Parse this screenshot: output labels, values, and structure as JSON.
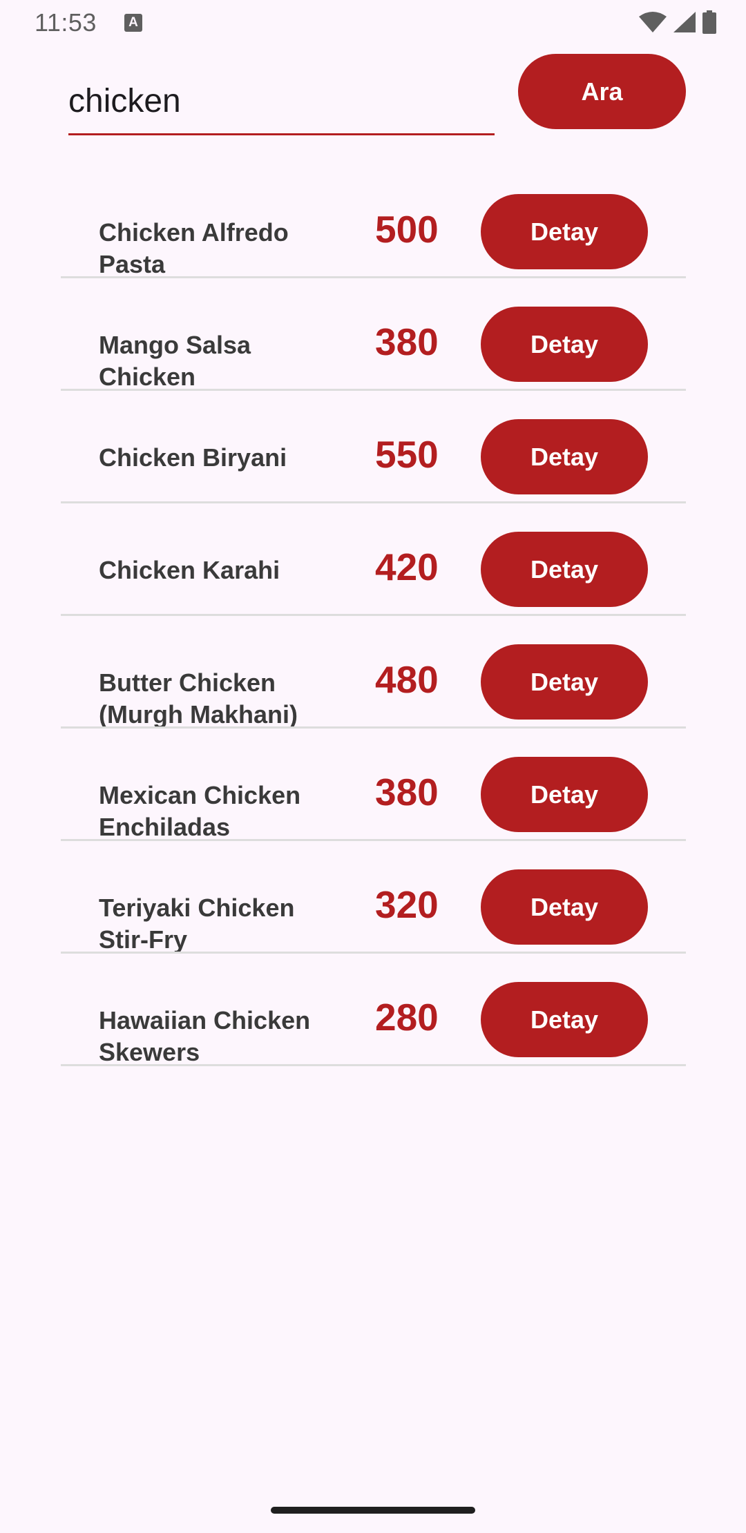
{
  "status_bar": {
    "time": "11:53",
    "notification_icon": "a-icon",
    "notification_glyph": "A",
    "icons": [
      "wifi-icon",
      "signal-icon",
      "battery-icon"
    ]
  },
  "search": {
    "value": "chicken",
    "button_label": "Ara"
  },
  "colors": {
    "accent": "#b31e20",
    "background": "#fdf6fd",
    "divider": "#dddddd"
  },
  "results": [
    {
      "name": "Chicken Alfredo Pasta",
      "price": "500",
      "button_label": "Detay"
    },
    {
      "name": "Mango Salsa Chicken",
      "price": "380",
      "button_label": "Detay"
    },
    {
      "name": "Chicken Biryani",
      "price": "550",
      "button_label": "Detay"
    },
    {
      "name": "Chicken Karahi",
      "price": "420",
      "button_label": "Detay"
    },
    {
      "name": "Butter Chicken (Murgh Makhani)",
      "price": "480",
      "button_label": "Detay"
    },
    {
      "name": "Mexican Chicken Enchiladas",
      "price": "380",
      "button_label": "Detay"
    },
    {
      "name": "Teriyaki Chicken Stir-Fry",
      "price": "320",
      "button_label": "Detay"
    },
    {
      "name": "Hawaiian Chicken Skewers",
      "price": "280",
      "button_label": "Detay"
    }
  ]
}
